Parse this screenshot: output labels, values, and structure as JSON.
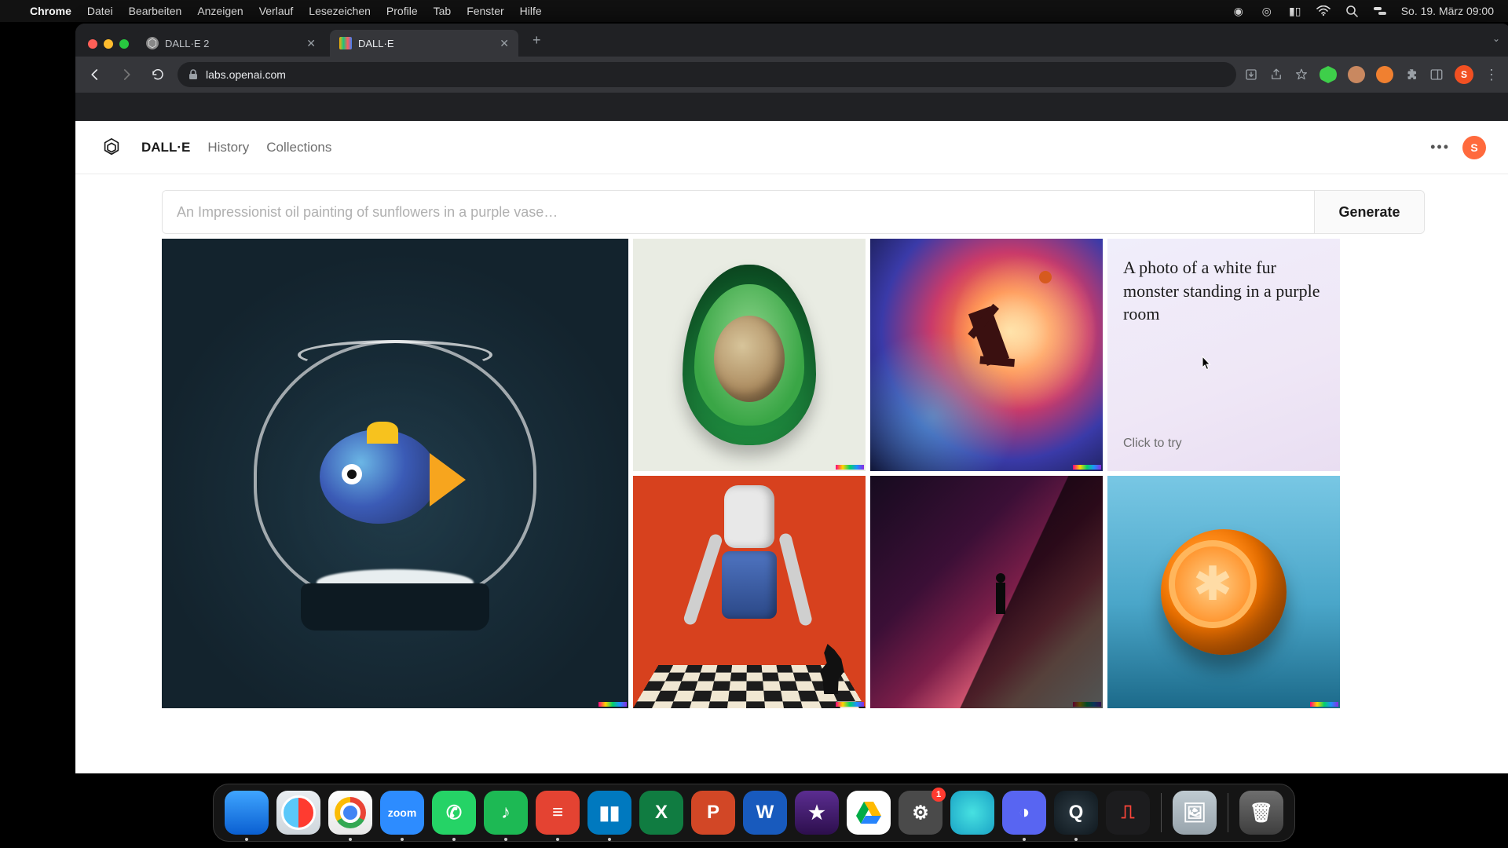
{
  "menubar": {
    "app": "Chrome",
    "items": [
      "Datei",
      "Bearbeiten",
      "Anzeigen",
      "Verlauf",
      "Lesezeichen",
      "Profile",
      "Tab",
      "Fenster",
      "Hilfe"
    ],
    "clock": "So. 19. März  09:00"
  },
  "browser": {
    "tabs": [
      {
        "title": "DALL·E 2",
        "active": false
      },
      {
        "title": "DALL·E",
        "active": true
      }
    ],
    "url": "labs.openai.com",
    "profile_initial": "S"
  },
  "app": {
    "nav": {
      "brand": "DALL·E",
      "history": "History",
      "collections": "Collections"
    },
    "user_initial": "S",
    "prompt_placeholder": "An Impressionist oil painting of sunflowers in a purple vase…",
    "generate_label": "Generate",
    "sample_prompt": {
      "text": "A photo of a white fur monster standing in a purple room",
      "cta": "Click to try"
    }
  },
  "dock": {
    "settings_badge": "1"
  }
}
